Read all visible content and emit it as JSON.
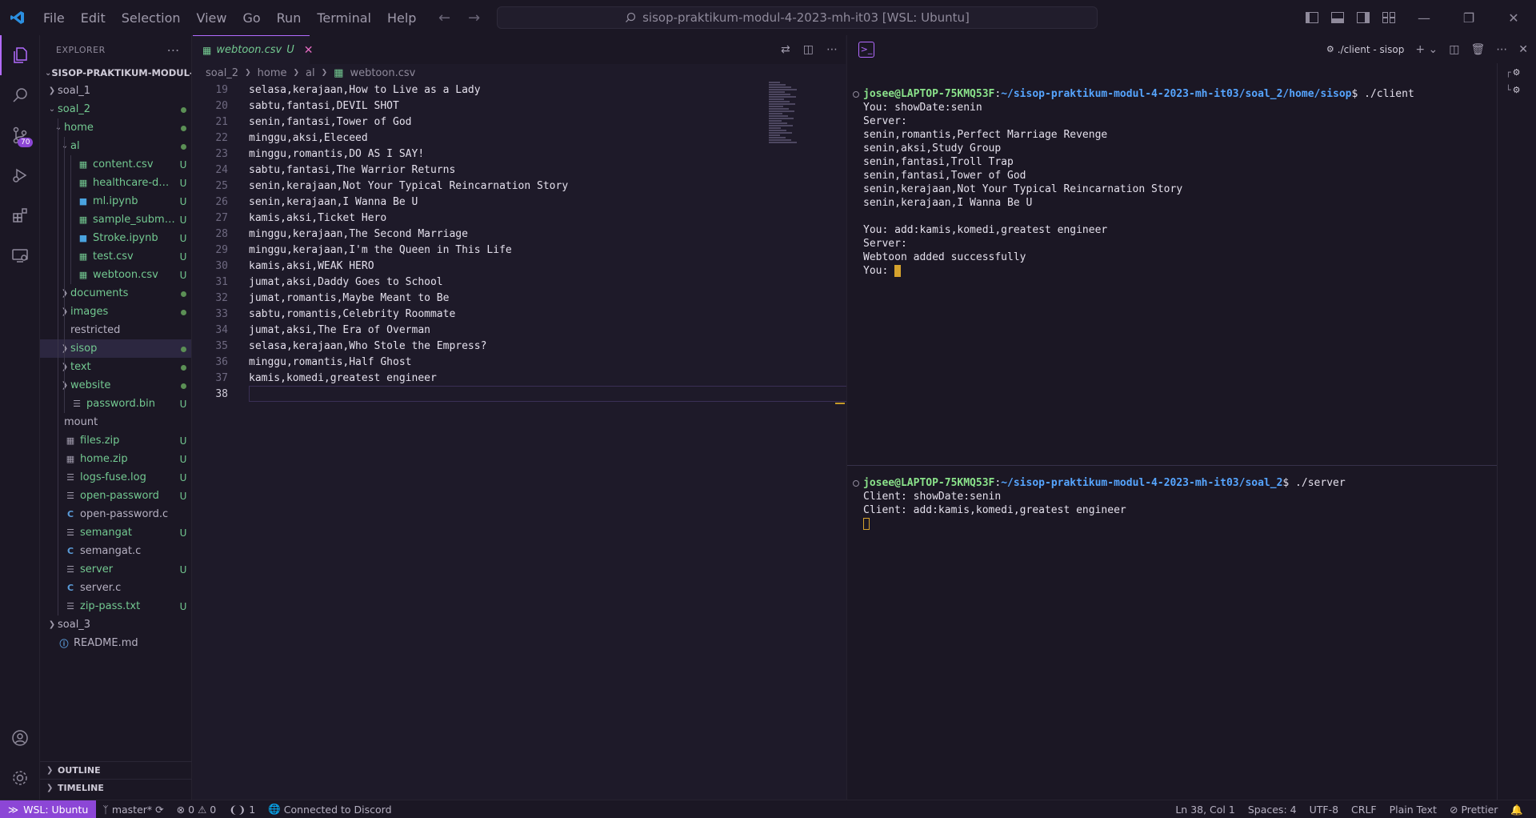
{
  "titlebar": {
    "menus": [
      "File",
      "Edit",
      "Selection",
      "View",
      "Go",
      "Run",
      "Terminal",
      "Help"
    ],
    "search_text": "sisop-praktikum-modul-4-2023-mh-it03 [WSL: Ubuntu]"
  },
  "activity": {
    "scm_badge": "70"
  },
  "sidebar": {
    "header": "EXPLORER",
    "folder": "SISOP-PRAKTIKUM-MODUL-...",
    "tree": [
      {
        "label": "soal_1",
        "depth": 0,
        "type": "folder",
        "open": false,
        "status": "",
        "color": "dim"
      },
      {
        "label": "soal_2",
        "depth": 0,
        "type": "folder",
        "open": true,
        "status": "dot",
        "color": "green"
      },
      {
        "label": "home",
        "depth": 1,
        "type": "folder",
        "open": true,
        "status": "dot",
        "color": "green"
      },
      {
        "label": "al",
        "depth": 2,
        "type": "folder",
        "open": true,
        "status": "dot",
        "color": "green"
      },
      {
        "label": "content.csv",
        "depth": 3,
        "type": "csv",
        "status": "U",
        "color": "green"
      },
      {
        "label": "healthcare-dat...",
        "depth": 3,
        "type": "csv",
        "status": "U",
        "color": "green"
      },
      {
        "label": "ml.ipynb",
        "depth": 3,
        "type": "nb",
        "status": "U",
        "color": "green"
      },
      {
        "label": "sample_submi...",
        "depth": 3,
        "type": "csv",
        "status": "U",
        "color": "green"
      },
      {
        "label": "Stroke.ipynb",
        "depth": 3,
        "type": "nb",
        "status": "U",
        "color": "green"
      },
      {
        "label": "test.csv",
        "depth": 3,
        "type": "csv",
        "status": "U",
        "color": "green"
      },
      {
        "label": "webtoon.csv",
        "depth": 3,
        "type": "csv",
        "status": "U",
        "color": "green"
      },
      {
        "label": "documents",
        "depth": 2,
        "type": "folder",
        "open": false,
        "status": "dot",
        "color": "green"
      },
      {
        "label": "images",
        "depth": 2,
        "type": "folder",
        "open": false,
        "status": "dot",
        "color": "green"
      },
      {
        "label": "restricted",
        "depth": 2,
        "type": "folder",
        "open": false,
        "status": "",
        "color": "dim",
        "nochev": true
      },
      {
        "label": "sisop",
        "depth": 2,
        "type": "folder",
        "open": false,
        "status": "dot",
        "color": "green",
        "selected": true
      },
      {
        "label": "text",
        "depth": 2,
        "type": "folder",
        "open": false,
        "status": "dot",
        "color": "green"
      },
      {
        "label": "website",
        "depth": 2,
        "type": "folder",
        "open": false,
        "status": "dot",
        "color": "green"
      },
      {
        "label": "password.bin",
        "depth": 2,
        "type": "bin",
        "status": "U",
        "color": "green"
      },
      {
        "label": "mount",
        "depth": 1,
        "type": "folder",
        "open": false,
        "status": "",
        "color": "dim",
        "nochev": true
      },
      {
        "label": "files.zip",
        "depth": 1,
        "type": "zip",
        "status": "U",
        "color": "green"
      },
      {
        "label": "home.zip",
        "depth": 1,
        "type": "zip",
        "status": "U",
        "color": "green"
      },
      {
        "label": "logs-fuse.log",
        "depth": 1,
        "type": "file",
        "status": "U",
        "color": "green"
      },
      {
        "label": "open-password",
        "depth": 1,
        "type": "file",
        "status": "U",
        "color": "green"
      },
      {
        "label": "open-password.c",
        "depth": 1,
        "type": "c",
        "status": "",
        "color": "dim"
      },
      {
        "label": "semangat",
        "depth": 1,
        "type": "file",
        "status": "U",
        "color": "green"
      },
      {
        "label": "semangat.c",
        "depth": 1,
        "type": "c",
        "status": "",
        "color": "dim"
      },
      {
        "label": "server",
        "depth": 1,
        "type": "file",
        "status": "U",
        "color": "green"
      },
      {
        "label": "server.c",
        "depth": 1,
        "type": "c",
        "status": "",
        "color": "dim"
      },
      {
        "label": "zip-pass.txt",
        "depth": 1,
        "type": "file",
        "status": "U",
        "color": "green"
      },
      {
        "label": "soal_3",
        "depth": 0,
        "type": "folder",
        "open": false,
        "status": "",
        "color": "dim"
      },
      {
        "label": "README.md",
        "depth": 0,
        "type": "info",
        "status": "",
        "color": "dim",
        "nochev": true
      }
    ],
    "outline": "OUTLINE",
    "timeline": "TIMELINE"
  },
  "editor": {
    "tab_label": "webtoon.csv",
    "tab_status": "U",
    "breadcrumb": [
      "soal_2",
      "home",
      "al",
      "webtoon.csv"
    ],
    "lines": [
      {
        "n": "19",
        "t": "selasa,kerajaan,How to Live as a Lady"
      },
      {
        "n": "20",
        "t": "sabtu,fantasi,DEVIL SHOT"
      },
      {
        "n": "21",
        "t": "senin,fantasi,Tower of God"
      },
      {
        "n": "22",
        "t": "minggu,aksi,Eleceed"
      },
      {
        "n": "23",
        "t": "minggu,romantis,DO AS I SAY!"
      },
      {
        "n": "24",
        "t": "sabtu,fantasi,The Warrior Returns"
      },
      {
        "n": "25",
        "t": "senin,kerajaan,Not Your Typical Reincarnation Story"
      },
      {
        "n": "26",
        "t": "senin,kerajaan,I Wanna Be U"
      },
      {
        "n": "27",
        "t": "kamis,aksi,Ticket Hero"
      },
      {
        "n": "28",
        "t": "minggu,kerajaan,The Second Marriage"
      },
      {
        "n": "29",
        "t": "minggu,kerajaan,I'm the Queen in This Life"
      },
      {
        "n": "30",
        "t": "kamis,aksi,WEAK HERO"
      },
      {
        "n": "31",
        "t": "jumat,aksi,Daddy Goes to School"
      },
      {
        "n": "32",
        "t": "jumat,romantis,Maybe Meant to Be"
      },
      {
        "n": "33",
        "t": "sabtu,romantis,Celebrity Roommate"
      },
      {
        "n": "34",
        "t": "jumat,aksi,The Era of Overman"
      },
      {
        "n": "35",
        "t": "selasa,kerajaan,Who Stole the Empress?"
      },
      {
        "n": "36",
        "t": "minggu,romantis,Half Ghost"
      },
      {
        "n": "37",
        "t": "kamis,komedi,greatest engineer"
      },
      {
        "n": "38",
        "t": ""
      }
    ]
  },
  "panel": {
    "terminal_name": "./client - sisop",
    "term1": {
      "user": "josee@LAPTOP-75KMQ53F",
      "path": "~/sisop-praktikum-modul-4-2023-mh-it03/soal_2/home/sisop",
      "command": "$ ./client",
      "output": [
        "You: showDate:senin",
        "Server:",
        "senin,romantis,Perfect Marriage Revenge",
        "senin,aksi,Study Group",
        "senin,fantasi,Troll Trap",
        "senin,fantasi,Tower of God",
        "senin,kerajaan,Not Your Typical Reincarnation Story",
        "senin,kerajaan,I Wanna Be U",
        "",
        "You: add:kamis,komedi,greatest engineer",
        "Server:",
        "Webtoon added successfully"
      ],
      "last_prompt": "You: "
    },
    "term2": {
      "user": "josee@LAPTOP-75KMQ53F",
      "path": "~/sisop-praktikum-modul-4-2023-mh-it03/soal_2",
      "command": "$ ./server",
      "output": [
        "Client: showDate:senin",
        "Client: add:kamis,komedi,greatest engineer"
      ]
    }
  },
  "statusbar": {
    "remote": "WSL: Ubuntu",
    "branch": "master*",
    "errors": "0",
    "warnings": "0",
    "ports": "1",
    "discord": "Connected to Discord",
    "position": "Ln 38, Col 1",
    "spaces": "Spaces: 4",
    "encoding": "UTF-8",
    "eol": "CRLF",
    "language": "Plain Text",
    "formatter": "Prettier"
  }
}
